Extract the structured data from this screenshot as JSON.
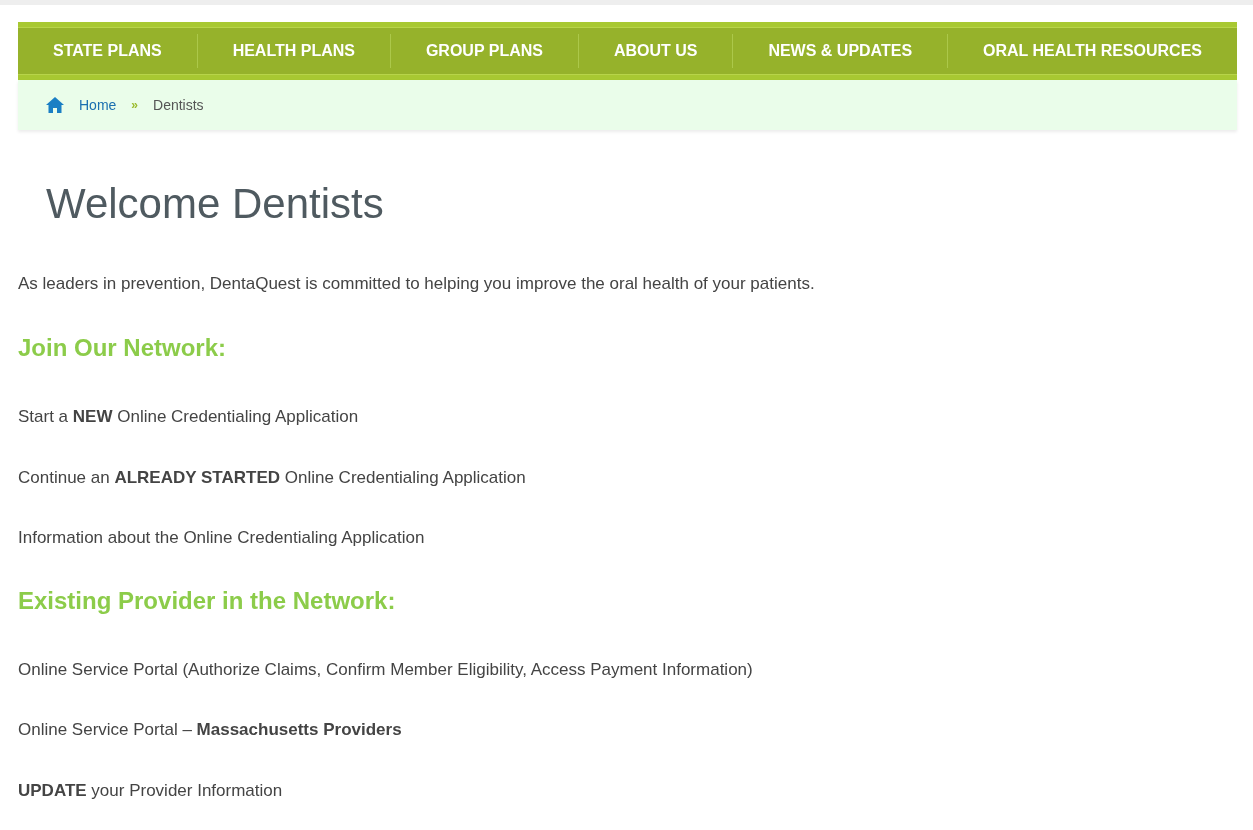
{
  "nav": [
    {
      "label": "STATE PLANS"
    },
    {
      "label": "HEALTH PLANS"
    },
    {
      "label": "GROUP PLANS"
    },
    {
      "label": "ABOUT US"
    },
    {
      "label": "NEWS & UPDATES"
    },
    {
      "label": "ORAL HEALTH RESOURCES"
    }
  ],
  "breadcrumb": {
    "home": "Home",
    "separator": "»",
    "current": "Dentists"
  },
  "title": "Welcome Dentists",
  "intro": "As leaders in prevention, DentaQuest is committed to helping you improve the oral health of your patients.",
  "sections": [
    {
      "heading": "Join Our Network:",
      "links": [
        "Start a **NEW** Online Credentialing Application",
        "Continue an **ALREADY STARTED** Online Credentialing Application",
        "Information about the Online Credentialing Application"
      ]
    },
    {
      "heading": "Existing Provider in the Network:",
      "links": [
        "Online Service Portal (Authorize Claims, Confirm Member Eligibility, Access Payment Information)",
        "Online Service Portal – **Massachusetts Providers**",
        "**UPDATE** your Provider Information"
      ]
    }
  ]
}
